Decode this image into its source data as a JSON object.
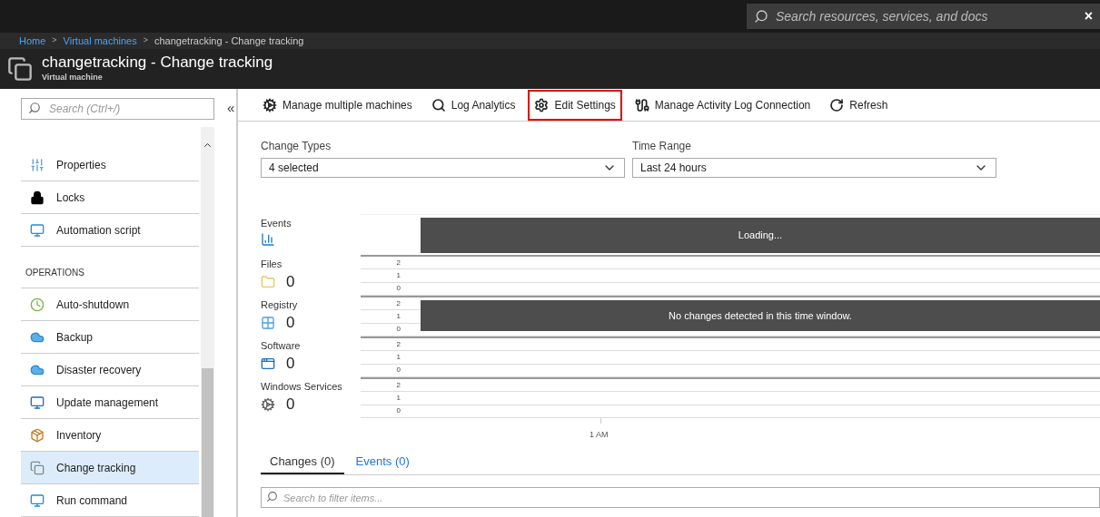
{
  "top_bar": {
    "search": {
      "placeholder": "Search resources, services, and docs"
    },
    "close": "×"
  },
  "breadcrumb": [
    {
      "label": "Home",
      "link": true
    },
    {
      "label": "Virtual machines",
      "link": true
    },
    {
      "label": "changetracking - Change tracking",
      "link": false
    }
  ],
  "separator": ">",
  "header": {
    "title": "changetracking - Change tracking",
    "subtitle": "Virtual machine"
  },
  "sidebar": {
    "search": {
      "placeholder": "Search (Ctrl+/)"
    },
    "collapse": "«",
    "groups": [
      {
        "items": [
          {
            "label": "Properties",
            "selected": false
          },
          {
            "label": "Locks",
            "selected": false
          },
          {
            "label": "Automation script",
            "selected": false
          }
        ]
      },
      {
        "heading": "OPERATIONS",
        "items": [
          {
            "label": "Auto-shutdown",
            "selected": false
          },
          {
            "label": "Backup",
            "selected": false
          },
          {
            "label": "Disaster recovery",
            "selected": false
          },
          {
            "label": "Update management",
            "selected": false
          },
          {
            "label": "Inventory",
            "selected": false
          },
          {
            "label": "Change tracking",
            "selected": true
          },
          {
            "label": "Run command",
            "selected": false
          }
        ]
      }
    ]
  },
  "toolbar": [
    {
      "label": "Manage multiple machines",
      "highlighted": false
    },
    {
      "label": "Log Analytics",
      "highlighted": false
    },
    {
      "label": "Edit Settings",
      "highlighted": true
    },
    {
      "label": "Manage Activity Log Connection",
      "highlighted": false
    },
    {
      "label": "Refresh",
      "highlighted": false
    }
  ],
  "filters": [
    {
      "label": "Change Types",
      "value": "4 selected"
    },
    {
      "label": "Time Range",
      "value": "Last 24 hours"
    }
  ],
  "timeline": {
    "rows": [
      {
        "kind": "events",
        "label": "Events",
        "overlay": "Loading..."
      },
      {
        "kind": "count",
        "label": "Files",
        "count": "0",
        "ticks": [
          "2",
          "1",
          "0"
        ]
      },
      {
        "kind": "count",
        "label": "Registry",
        "count": "0",
        "ticks": [
          "2",
          "1",
          "0"
        ],
        "overlay": "No changes detected in this time window."
      },
      {
        "kind": "count",
        "label": "Software",
        "count": "0",
        "ticks": [
          "2",
          "1",
          "0"
        ]
      },
      {
        "kind": "count",
        "label": "Windows Services",
        "count": "0",
        "ticks": [
          "2",
          "1",
          "0"
        ]
      }
    ],
    "x_label": "1 AM"
  },
  "tabs": [
    {
      "label": "Changes (0)",
      "selected": true
    },
    {
      "label": "Events (0)",
      "selected": false
    }
  ],
  "filter_search": {
    "placeholder": "Search to filter items..."
  }
}
